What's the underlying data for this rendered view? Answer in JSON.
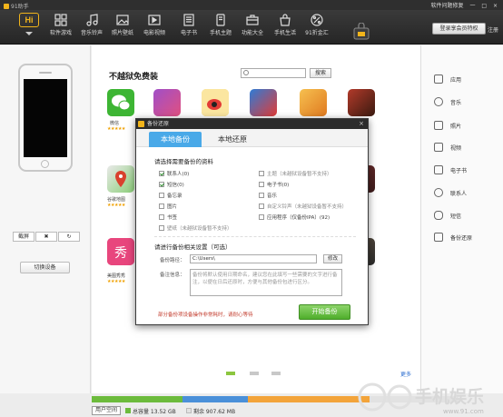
{
  "titlebar": {
    "app_title": "91助手",
    "right_links": [
      "软件问题修复",
      "一",
      "□",
      "×"
    ]
  },
  "toolbar": {
    "brand": "Hi",
    "items": [
      {
        "label": "软件游戏",
        "icon": "apps-grid-icon"
      },
      {
        "label": "音乐铃声",
        "icon": "music-note-icon"
      },
      {
        "label": "照片壁纸",
        "icon": "photo-icon"
      },
      {
        "label": "电影视频",
        "icon": "video-play-icon"
      },
      {
        "label": "电子书",
        "icon": "ebook-icon"
      },
      {
        "label": "手机主题",
        "icon": "theme-icon"
      },
      {
        "label": "功能大全",
        "icon": "toolbox-icon"
      },
      {
        "label": "手机生活",
        "icon": "shopping-bag-icon"
      },
      {
        "label": "91折金汇",
        "icon": "discount-icon"
      }
    ],
    "charge_button": "登录享会员特权",
    "register": "注册"
  },
  "left": {
    "controls": [
      "截屏",
      "✖",
      "↻"
    ],
    "switch_device": "切换设备"
  },
  "center": {
    "title": "不越狱免费装",
    "search_button": "搜索",
    "apps": [
      {
        "name": "微信",
        "color": "#3db534",
        "stars": "★★★★★"
      },
      {
        "name": "",
        "color": "#c64a9b",
        "stars": "★★★★★"
      },
      {
        "name": "",
        "color": "#e23b36",
        "stars": "★★★★★"
      },
      {
        "name": "",
        "color": "#2e7bd6",
        "stars": "★★★★★"
      },
      {
        "name": "",
        "color": "#f0a040",
        "stars": "★★★★★"
      },
      {
        "name": "",
        "color": "#a33",
        "stars": "★★★★★"
      },
      {
        "name": "谷歌地图",
        "color": "#e9e9e9",
        "stars": "★★★★★"
      },
      {
        "name": "",
        "color": "#7a3030",
        "stars": "★★★★"
      },
      {
        "name": "美图秀秀",
        "color": "#e8467d",
        "stars": "★★★★★"
      },
      {
        "name": "",
        "color": "#665544",
        "stars": "★★★★"
      }
    ],
    "more": "更多"
  },
  "right_nav": [
    {
      "label": "应用",
      "icon": "cube-icon"
    },
    {
      "label": "音乐",
      "icon": "music-icon"
    },
    {
      "label": "照片",
      "icon": "picture-icon"
    },
    {
      "label": "视频",
      "icon": "film-icon"
    },
    {
      "label": "电子书",
      "icon": "book-icon"
    },
    {
      "label": "联系人",
      "icon": "contacts-icon"
    },
    {
      "label": "短信",
      "icon": "message-icon"
    },
    {
      "label": "备份还原",
      "icon": "backup-icon"
    }
  ],
  "dialog": {
    "title": "备份还原",
    "close": "×",
    "tabs": [
      "本地备份",
      "本地还原"
    ],
    "section1_title": "请选择需要备份的资料",
    "items_left": [
      {
        "label": "联系人(0)",
        "checked": true,
        "dim": false
      },
      {
        "label": "短信(0)",
        "checked": true,
        "dim": false
      },
      {
        "label": "备忘录",
        "checked": false,
        "dim": false
      },
      {
        "label": "图片",
        "checked": false,
        "dim": false
      },
      {
        "label": "书签",
        "checked": false,
        "dim": false
      },
      {
        "label": "壁纸（未越狱设备暂不支持）",
        "checked": false,
        "dim": true
      }
    ],
    "items_right": [
      {
        "label": "主题（未越狱设备暂不支持）",
        "checked": false,
        "dim": true
      },
      {
        "label": "电子书(0)",
        "checked": false,
        "dim": false
      },
      {
        "label": "音乐",
        "checked": false,
        "dim": false
      },
      {
        "label": "自定义铃声（未越狱设备暂不支持）",
        "checked": false,
        "dim": true
      },
      {
        "label": "应用程序（仅备份IPA）(92)",
        "checked": false,
        "dim": false
      }
    ],
    "section2_title": "请进行备份相关设置（可选）",
    "path_label": "备份路径：",
    "path_value": "C:\\Users\\",
    "modify_button": "修改",
    "note_label": "备注信息：",
    "note_placeholder": "备份将默认使用日期命名，建议您在此填写一些需要的文字进行备注，以便在日后还原时，方便与其他备份包进行区分。",
    "warning": "部分备份项设备操作非常耗时，请耐心等待",
    "start_button": "开始备份"
  },
  "status": {
    "capacity_button": "用户空间",
    "total_label": "总容量 13.52 GB",
    "free_label": "剩余 907.62 MB",
    "colors": {
      "used_green": "#6cbb3c",
      "used_blue": "#4a90d9",
      "used_orange": "#f3a43a",
      "free": "#e2e2e2"
    }
  },
  "watermark": {
    "text": "手机娱乐",
    "url": "www.91.com"
  }
}
